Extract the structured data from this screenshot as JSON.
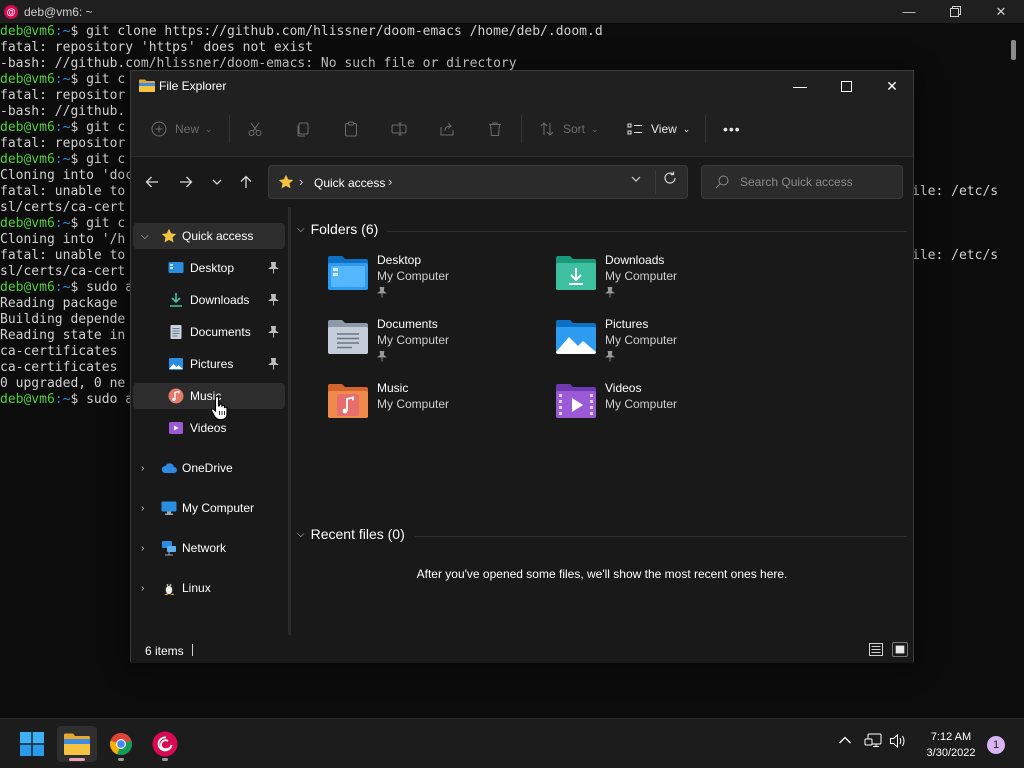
{
  "terminal": {
    "title": "deb@vm6: ~",
    "prompt_user": "deb@vm6",
    "prompt_path": ":~",
    "lines": [
      {
        "type": "prompt",
        "text": "$ git clone https://github.com/hlissner/doom-emacs /home/deb/.doom.d"
      },
      {
        "type": "out",
        "text": "fatal: repository 'https' does not exist"
      },
      {
        "type": "out",
        "text": "-bash: //github.com/hlissner/doom-emacs: No such file or directory"
      },
      {
        "type": "prompt",
        "text": "$ git c"
      },
      {
        "type": "out",
        "text": "fatal: repositor"
      },
      {
        "type": "out",
        "text": "-bash: //github."
      },
      {
        "type": "prompt",
        "text": "$ git c"
      },
      {
        "type": "out",
        "text": "fatal: repositor"
      },
      {
        "type": "prompt",
        "text": "$ git c"
      },
      {
        "type": "out",
        "text": "Cloning into 'doc"
      },
      {
        "type": "out",
        "text": "fatal: unable to"
      },
      {
        "type": "out",
        "text": "sl/certs/ca-cert"
      },
      {
        "type": "prompt",
        "text": "$ git c"
      },
      {
        "type": "out",
        "text": "Cloning into '/h"
      },
      {
        "type": "out",
        "text": "fatal: unable to"
      },
      {
        "type": "out",
        "text": "sl/certs/ca-cert"
      },
      {
        "type": "prompt",
        "text": "$ sudo a"
      },
      {
        "type": "out",
        "text": "Reading package"
      },
      {
        "type": "out",
        "text": "Building depende"
      },
      {
        "type": "out",
        "text": "Reading state in"
      },
      {
        "type": "out",
        "text": "ca-certificates"
      },
      {
        "type": "out",
        "text": "ca-certificates"
      },
      {
        "type": "out",
        "text": "0 upgraded, 0 ne"
      },
      {
        "type": "prompt",
        "text": "$ sudo a"
      }
    ],
    "right_fragment_1": "ile: /etc/s",
    "right_fragment_2": "ile: /etc/s"
  },
  "explorer": {
    "title": "File Explorer",
    "toolbar": {
      "new_label": "New",
      "sort_label": "Sort",
      "view_label": "View",
      "more_label": "•••"
    },
    "address": {
      "crumb": "Quick access",
      "sep": "›",
      "search_placeholder": "Search Quick access"
    },
    "sidebar": {
      "quick_access": "Quick access",
      "items": [
        {
          "label": "Desktop",
          "pinned": true
        },
        {
          "label": "Downloads",
          "pinned": true
        },
        {
          "label": "Documents",
          "pinned": true
        },
        {
          "label": "Pictures",
          "pinned": true
        },
        {
          "label": "Music",
          "pinned": false
        },
        {
          "label": "Videos",
          "pinned": false
        }
      ],
      "roots": [
        {
          "label": "OneDrive"
        },
        {
          "label": "My Computer"
        },
        {
          "label": "Network"
        },
        {
          "label": "Linux"
        }
      ]
    },
    "folders_header": "Folders (6)",
    "folders": [
      {
        "name": "Desktop",
        "location": "My Computer"
      },
      {
        "name": "Downloads",
        "location": "My Computer"
      },
      {
        "name": "Documents",
        "location": "My Computer"
      },
      {
        "name": "Pictures",
        "location": "My Computer"
      },
      {
        "name": "Music",
        "location": "My Computer"
      },
      {
        "name": "Videos",
        "location": "My Computer"
      }
    ],
    "recent_header": "Recent files (0)",
    "recent_empty": "After you've opened some files, we'll show the most recent ones here.",
    "status": {
      "count": "6 items"
    }
  },
  "taskbar": {
    "time": "7:12 AM",
    "date": "3/30/2022",
    "notifications": "1"
  },
  "colors": {
    "accent": "#0067c0",
    "prompt_user": "#4fce3d",
    "prompt_path": "#3a8bd6",
    "folder_yellow": "#f5c242"
  }
}
